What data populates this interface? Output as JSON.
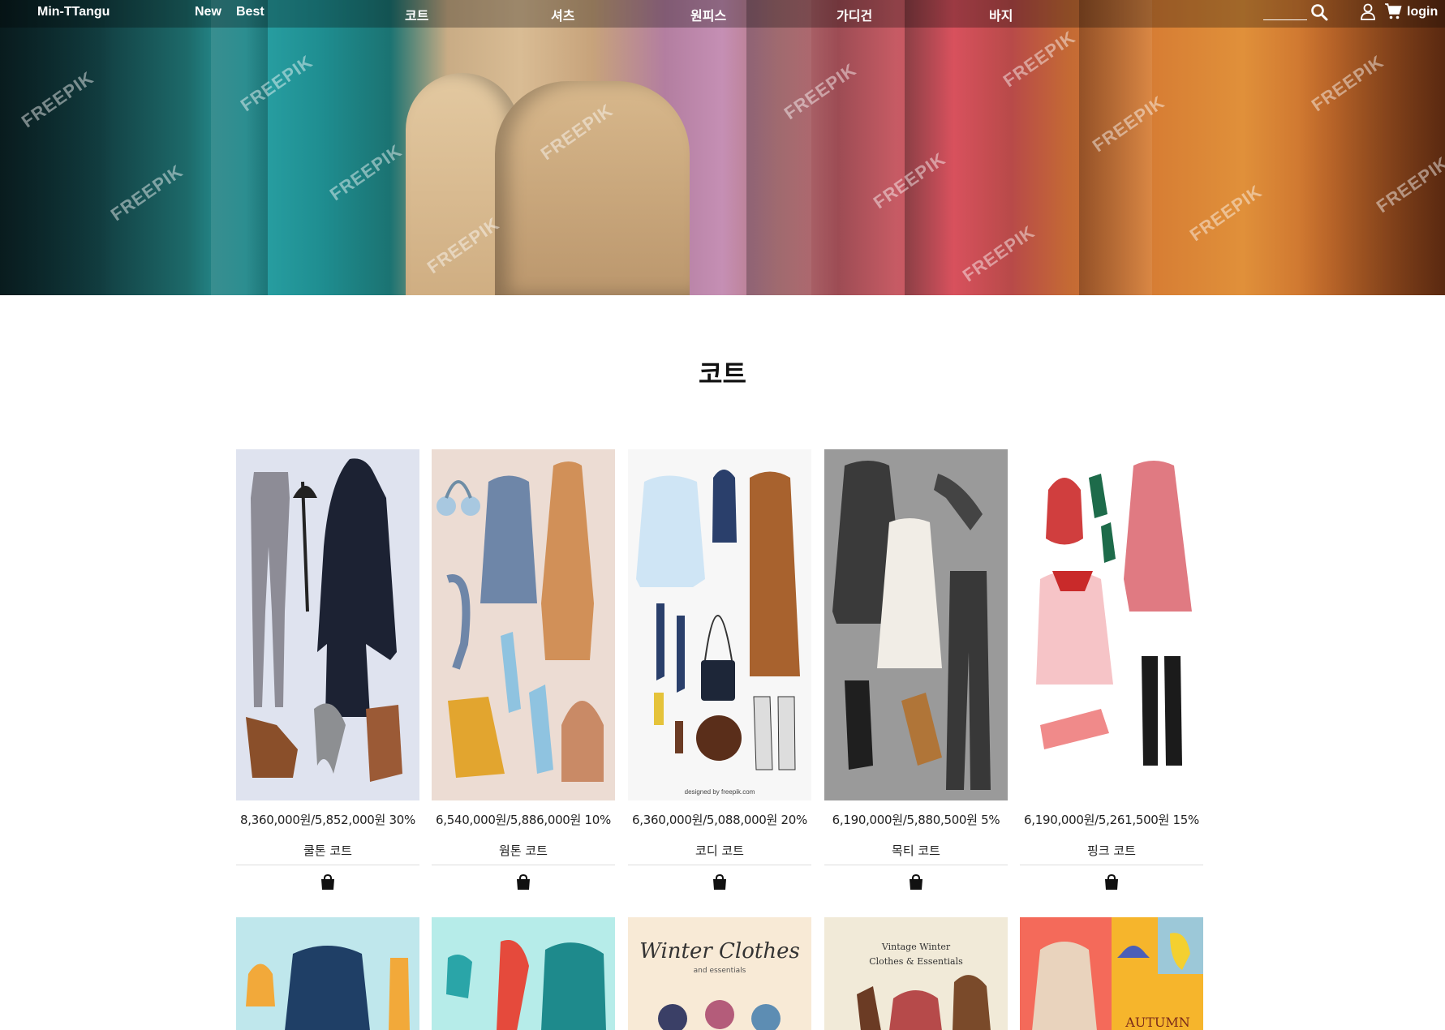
{
  "nav": {
    "brand": "Min-TTangu",
    "new": "New",
    "best": "Best",
    "menu": [
      "코트",
      "셔츠",
      "원피스",
      "가디건",
      "바지"
    ],
    "login": "login"
  },
  "hero": {
    "watermark": "FREEPIK"
  },
  "section": {
    "title": "코트"
  },
  "products": [
    {
      "price": "8,360,000원/5,852,000원 30%",
      "name": "쿨톤 코트",
      "bg": "#dfe3ef"
    },
    {
      "price": "6,540,000원/5,886,000원 10%",
      "name": "웜톤 코트",
      "bg": "#ecdcd3"
    },
    {
      "price": "6,360,000원/5,088,000원 20%",
      "name": "코디 코트",
      "bg": "#f7f7f7"
    },
    {
      "price": "6,190,000원/5,880,500원 5%",
      "name": "목티 코트",
      "bg": "#9a9a9a"
    },
    {
      "price": "6,190,000원/5,261,500원 15%",
      "name": "핑크 코트",
      "bg": "#ffffff"
    }
  ],
  "row2": [
    {
      "bg": "#bfe7ec"
    },
    {
      "bg": "#b6ece9"
    },
    {
      "bg": "#f8ead6",
      "text1": "Winter Clothes",
      "text2": "and essentials"
    },
    {
      "bg": "#f1ead8",
      "text1": "Vintage Winter",
      "text2": "Clothes & Essentials"
    },
    {
      "bg": "#f46a5a",
      "text1": "AUTUMN"
    }
  ]
}
